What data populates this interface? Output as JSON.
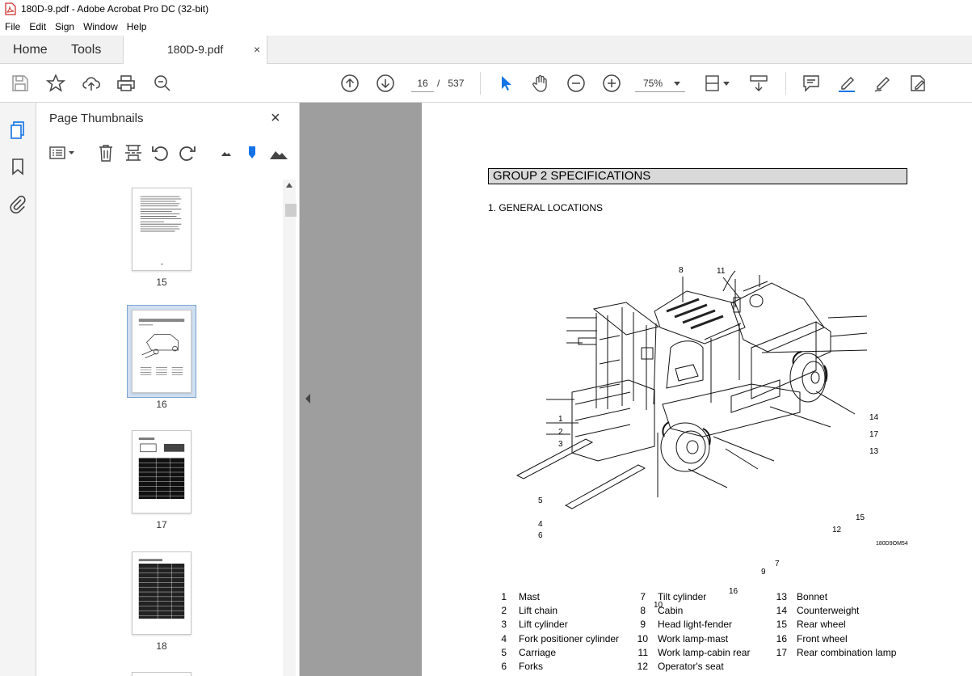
{
  "window": {
    "title": "180D-9.pdf - Adobe Acrobat Pro DC (32-bit)"
  },
  "menu": [
    "File",
    "Edit",
    "Sign",
    "Window",
    "Help"
  ],
  "tabs": {
    "home": "Home",
    "tools": "Tools",
    "document": "180D-9.pdf",
    "close": "×"
  },
  "toolbar": {
    "current_page": "16",
    "page_separator": "/",
    "total_pages": "537",
    "zoom": "75%"
  },
  "sidebar": {
    "title": "Page Thumbnails",
    "close": "×",
    "thumbnails": [
      {
        "label": "15"
      },
      {
        "label": "16",
        "selected": true
      },
      {
        "label": "17"
      },
      {
        "label": "18"
      }
    ]
  },
  "document": {
    "group_header": "GROUP 2  SPECIFICATIONS",
    "section_title": "1. GENERAL LOCATIONS",
    "figure_code": "180D9OM54",
    "callouts": [
      "1",
      "2",
      "3",
      "4",
      "5",
      "6",
      "7",
      "8",
      "9",
      "10",
      "11",
      "12",
      "13",
      "14",
      "15",
      "16",
      "17"
    ],
    "legend": [
      {
        "num": "1",
        "text": "Mast"
      },
      {
        "num": "2",
        "text": "Lift chain"
      },
      {
        "num": "3",
        "text": "Lift cylinder"
      },
      {
        "num": "4",
        "text": "Fork positioner cylinder"
      },
      {
        "num": "5",
        "text": "Carriage"
      },
      {
        "num": "6",
        "text": "Forks"
      },
      {
        "num": "7",
        "text": "Tilt cylinder"
      },
      {
        "num": "8",
        "text": "Cabin"
      },
      {
        "num": "9",
        "text": "Head light-fender"
      },
      {
        "num": "10",
        "text": "Work lamp-mast"
      },
      {
        "num": "11",
        "text": "Work lamp-cabin rear"
      },
      {
        "num": "12",
        "text": "Operator's seat"
      },
      {
        "num": "13",
        "text": "Bonnet"
      },
      {
        "num": "14",
        "text": "Counterweight"
      },
      {
        "num": "15",
        "text": "Rear wheel"
      },
      {
        "num": "16",
        "text": "Front wheel"
      },
      {
        "num": "17",
        "text": "Rear combination lamp"
      }
    ]
  },
  "colors": {
    "accent": "#1473e6",
    "selection": "#cfdff0",
    "gray_bg": "#9e9e9e",
    "header_fill": "#d9d9d9"
  }
}
